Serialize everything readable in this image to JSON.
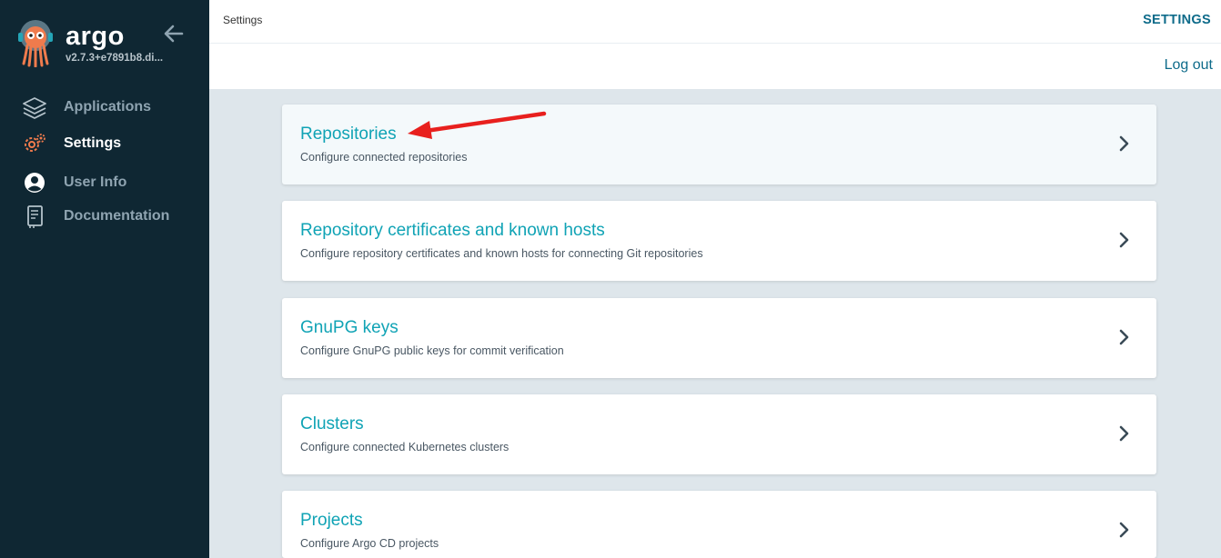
{
  "sidebar": {
    "brand": "argo",
    "version": "v2.7.3+e7891b8.di...",
    "items": [
      {
        "label": "Applications",
        "icon": "layers-icon"
      },
      {
        "label": "Settings",
        "icon": "gear-icon"
      },
      {
        "label": "User Info",
        "icon": "user-circle-icon"
      },
      {
        "label": "Documentation",
        "icon": "book-icon"
      }
    ]
  },
  "topbar": {
    "breadcrumb": "Settings",
    "title": "SETTINGS",
    "logout": "Log out"
  },
  "cards": [
    {
      "title": "Repositories",
      "description": "Configure connected repositories"
    },
    {
      "title": "Repository certificates and known hosts",
      "description": "Configure repository certificates and known hosts for connecting Git repositories"
    },
    {
      "title": "GnuPG keys",
      "description": "Configure GnuPG public keys for commit verification"
    },
    {
      "title": "Clusters",
      "description": "Configure connected Kubernetes clusters"
    },
    {
      "title": "Projects",
      "description": "Configure Argo CD projects"
    }
  ],
  "colors": {
    "sidebar_bg": "#0f2733",
    "accent": "#10a3b5",
    "link": "#0e6b8a",
    "page_bg": "#dee6eb",
    "annotation_arrow": "#e8201e"
  }
}
